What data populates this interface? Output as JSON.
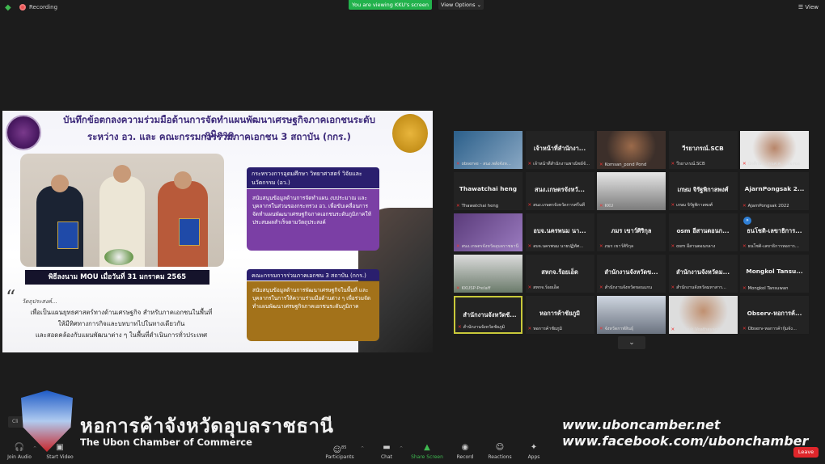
{
  "topbar": {
    "recording": "Recording",
    "viewing_banner": "You are viewing KKU's screen",
    "view_options": "View Options ⌄",
    "view_button": "View"
  },
  "slide": {
    "title_line1": "บันทึกข้อตกลงความร่วมมือด้านการจัดทำแผนพัฒนาเศรษฐกิจภาคเอกชนระดับภูมิภาค",
    "title_line2": "ระหว่าง อว. และ คณะกรรมการร่วมภาคเอกชน 3 สถาบัน (กกร.)",
    "caption": "พิธีลงนาม MOU เมื่อวันที่ 31 มกราคม 2565",
    "objective_head": "วัตถุประสงค์...",
    "objective_line1": "เพื่อเป็นแผนยุทธศาสตร์ทางด้านเศรษฐกิจ สำหรับภาคเอกชนในพื้นที่",
    "objective_line2": "ให้มีทิศทางการกิจและบทบาทไปในทางเดียวกัน",
    "objective_line3": "และสอดคล้องกับแผนพัฒนาต่าง ๆ ในพื้นที่ดำเนินการทั่วประเทศ",
    "box1_head": "กระทรวงการอุดมศึกษา วิทยาศาสตร์ วิจัยและนวัตกรรม (อว.)",
    "box1_text": "สนับสนุนข้อมูลด้านการจัดทำแผน งบประมาณ และบุคลากรในส่วนของกระทรวง อว. เพื่อขับเคลื่อนการจัดทำแผนพัฒนาเศรษฐกิจภาคเอกชนระดับภูมิภาคให้ประสบผลสำเร็จตามวัตถุประสงค์",
    "box2_head": "คณะกรรมการร่วมภาคเอกชน 3 สถาบัน (กกร.)",
    "box2_text": "สนับสนุนข้อมูลด้านการพัฒนาเศรษฐกิจในพื้นที่ และบุคลากรในการให้ความร่วมมือด้านต่าง ๆ เพื่อร่วมจัดทำแผนพัฒนาเศรษฐกิจภาคเอกชนระดับภูมิภาค"
  },
  "participants": [
    {
      "name": "",
      "label": "observe - สนง.พลังจังห..."
    },
    {
      "name": "เจ้าหน้าที่สำนักงา...",
      "label": "เจ้าหน้าที่สำนักงานพาณิชย์จั..."
    },
    {
      "name": "",
      "label": "Komsan_pond Pond"
    },
    {
      "name": "วีรยาภรณ์.SCB",
      "label": "วีรยาภรณ์.SCB"
    },
    {
      "name": "",
      "label": "นักศึกษา - กนศ.ศ. ...ร้องขอ"
    },
    {
      "name": "Thawatchai heng",
      "label": "Thawatchai heng"
    },
    {
      "name": "สนง.เกษตรจังหวั...",
      "label": "สนง.เกษตรจังหวัดการศรีนที"
    },
    {
      "name": "",
      "label": "KKU"
    },
    {
      "name": "เกษม จิรัฐพิกาลพงศ์",
      "label": "เกษม จิรัฐพิกาลพงศ์"
    },
    {
      "name": "AjarnPongsak 2...",
      "label": "AjarnPongsak 2022"
    },
    {
      "name": "",
      "label": "สนง.เกษตรจังหวัดอุบลราชธานี"
    },
    {
      "name": "อบจ.นครพนม นา...",
      "label": "อบจ.นครพนม นายปฏิทัศ..."
    },
    {
      "name": "ภมร เขาว์ศิริกุล",
      "label": "ภมร เขาว์ศิริกุล"
    },
    {
      "name": "osm อีสานตอนก...",
      "label": "osm อีสานตอนกลาง"
    },
    {
      "name": "ธนโชติ-เลขาธิการ...",
      "label": "ธนโชติ-เลขาธิการหอการ..."
    },
    {
      "name": "",
      "label": "KKUSP-Prelaff"
    },
    {
      "name": "สหกจ.ร้อยเอ็ด",
      "label": "สหกจ.ร้อยเอ็ด"
    },
    {
      "name": "สำนักงานจังหวัดข...",
      "label": "สำนักงานจังหวัดขอนแกน"
    },
    {
      "name": "สำนักงานจังหวัดม...",
      "label": "สำนักงานจังหวัดมหาสาร..."
    },
    {
      "name": "Mongkol Tansu...",
      "label": "Mongkol Tansuwan"
    },
    {
      "name": "สำนักงานจังหวัดชั...",
      "label": "สำนักงานจังหวัดชัยภูมิ"
    },
    {
      "name": "หอการค้าชัยภูมิ",
      "label": "หอการค้าชัยภูมิ"
    },
    {
      "name": "",
      "label": "จังหวัดกาฬสินธุ์"
    },
    {
      "name": "",
      "label": "Chaiyuk Veathayaphan"
    },
    {
      "name": "Observ-หอการค้...",
      "label": "Observ-หอการค้ากุ้มจัง..."
    }
  ],
  "watermark": {
    "thai_name": "หอการค้าจังหวัดอุบลราชธานี",
    "english_name": "The Ubon Chamber of Commerce",
    "website": "www.uboncamber.net",
    "facebook": "www.facebook.com/ubonchamber",
    "hint": "Cli"
  },
  "toolbar": {
    "join_audio": "Join Audio",
    "start_video": "Start Video",
    "participants": "Participants",
    "participants_count": "85",
    "chat": "Chat",
    "share_screen": "Share Screen",
    "record": "Record",
    "reactions": "Reactions",
    "apps": "Apps",
    "leave": "Leave"
  },
  "colors": {
    "share_green": "#22b24c",
    "leave_red": "#e0262b",
    "active_speaker": "#c8c83a"
  }
}
